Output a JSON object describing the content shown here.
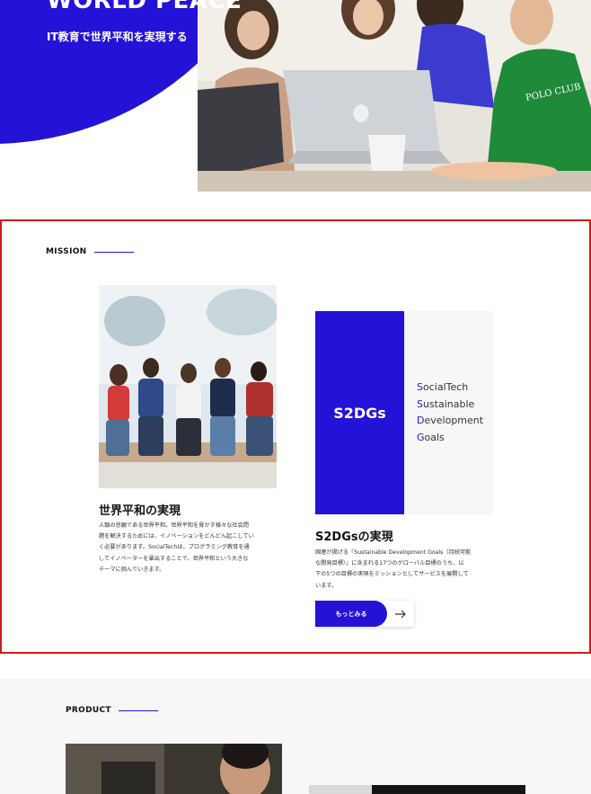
{
  "hero": {
    "title": "WORLD PEACE",
    "subtitle": "IT教育で世界平和を実現する",
    "image": "team-laptop-photo"
  },
  "mission": {
    "eyebrow": "MISSION",
    "image": "group-of-friends-photo",
    "left": {
      "heading": "世界平和の実現",
      "body": [
        "人類の悲願である世界平和。世界平和を脅かす様々な社会問",
        "題を解決するためには、イノベーションをどんどん起こしてい",
        "く必要があります。SocialTechは、プログラミング教育を通",
        "してイノベーターを輩出することで、世界平和という大きな",
        "テーマに挑んでいきます。"
      ]
    },
    "card": {
      "title": "S2DGs",
      "lines": [
        {
          "initial": "S",
          "rest": "ocialTech"
        },
        {
          "initial": "S",
          "rest": "ustainable"
        },
        {
          "initial": "D",
          "rest": "evelopment"
        },
        {
          "initial": "G",
          "rest": "oals"
        }
      ]
    },
    "right": {
      "heading": "S2DGsの実現",
      "body": [
        "国連が掲げる『Sustainable Development Goals（持続可能",
        "な開発目標）』に含まれる17つのグローバル目標のうち、以",
        "下の5つの目標の実現をミッションとしてサービスを展開して",
        "います。"
      ]
    },
    "more_button": {
      "label": "もっとみる",
      "icon": "arrow-right-icon"
    }
  },
  "product": {
    "eyebrow": "PRODUCT",
    "images": [
      "workspace-photo",
      "dark-product-photo"
    ]
  },
  "colors": {
    "accent": "#2412d6",
    "highlight_border": "#cc1b1b",
    "light_bg": "#f7f7f8"
  }
}
